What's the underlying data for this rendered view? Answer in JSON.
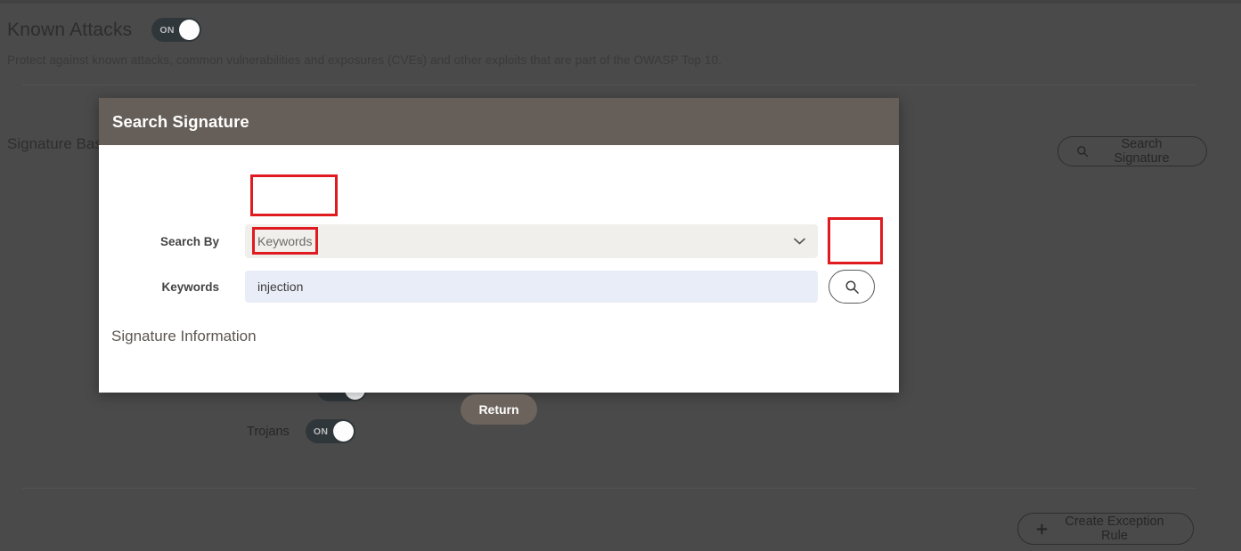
{
  "page": {
    "section_title": "Known Attacks",
    "section_toggle": {
      "label": "ON",
      "state": "on"
    },
    "description": "Protect against known attacks, common vulnerabilities and exposures (CVEs) and other exploits that are part of the OWASP Top 10.",
    "signature_based_label": "Signature Bas",
    "search_signature_button": "Search Signature",
    "create_exception_button": "Create Exception Rule",
    "create_exception_icon": "plus-icon",
    "search_icon_name": "search-icon",
    "trojans_label": "Trojans",
    "trojans_toggle": {
      "label": "ON",
      "state": "on"
    }
  },
  "modal": {
    "title": "Search Signature",
    "fields": {
      "search_by": {
        "label": "Search By",
        "value": "Keywords",
        "options": [
          "Keywords"
        ]
      },
      "keywords": {
        "label": "Keywords",
        "value": "injection",
        "placeholder": ""
      }
    },
    "search_icon_button": {
      "icon": "search-icon"
    },
    "signature_information_heading": "Signature Information",
    "return_button": "Return"
  },
  "annotations": {
    "highlight_color": "#e01b20",
    "boxes": [
      {
        "name": "search-by-value-highlight"
      },
      {
        "name": "keywords-value-highlight"
      },
      {
        "name": "search-icon-button-highlight"
      }
    ]
  },
  "colors": {
    "page_background": "#4a4a4a",
    "modal_header": "#665f59",
    "modal_body": "#ffffff",
    "select_background": "#f1efeb",
    "input_background": "#e8edf7",
    "return_button": "#6b635c",
    "toggle_on": "#30373a"
  }
}
